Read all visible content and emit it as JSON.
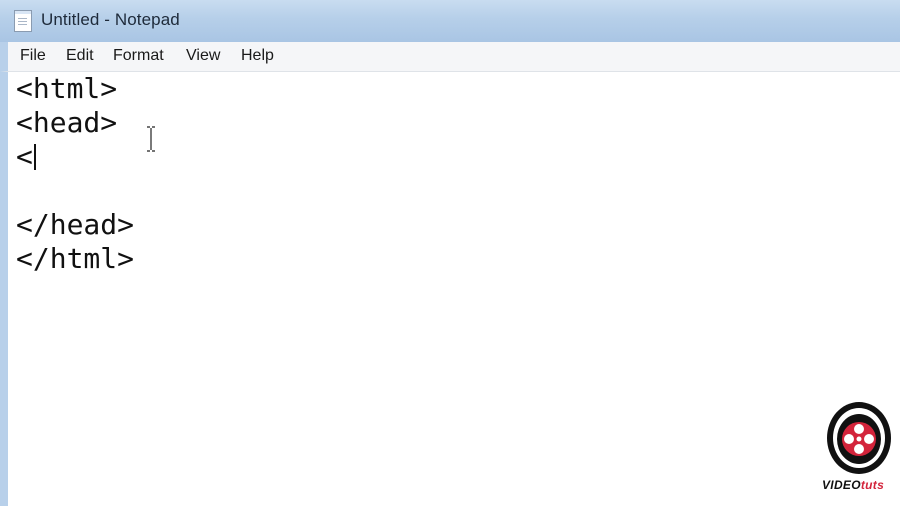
{
  "window": {
    "title": "Untitled - Notepad",
    "app_icon": "notepad-icon"
  },
  "menubar": {
    "items": [
      {
        "label": "File"
      },
      {
        "label": "Edit"
      },
      {
        "label": "Format"
      },
      {
        "label": "View"
      },
      {
        "label": "Help"
      }
    ]
  },
  "editor": {
    "lines": [
      "<html>",
      "<head>",
      "<",
      "",
      "</head>",
      "</html>"
    ],
    "caret_line": 3,
    "cursor": "text-ibeam-cursor"
  },
  "watermark": {
    "logo_icon": "film-reel-icon",
    "text_part1": "VIDEO",
    "text_part2": "tuts",
    "accent_color": "#d3243b"
  }
}
